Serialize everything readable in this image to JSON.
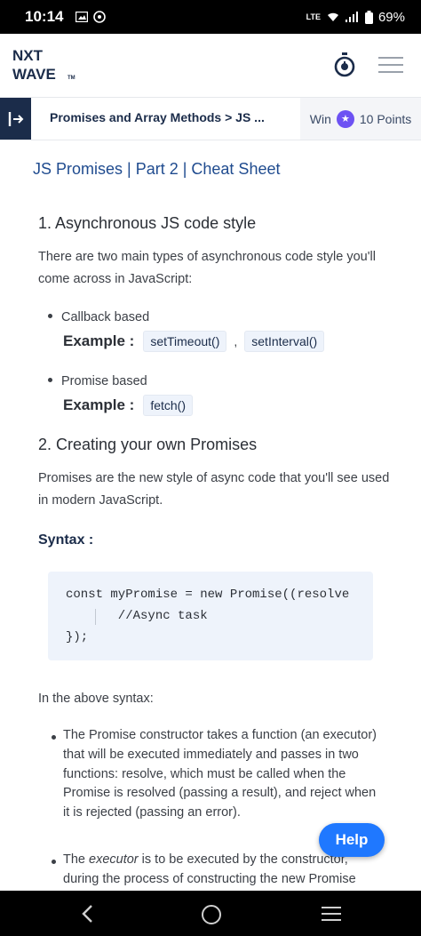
{
  "status_bar": {
    "time": "10:14",
    "network": "LTE",
    "battery": "69%"
  },
  "header": {
    "logo_line1": "NXT",
    "logo_line2": "WAVE",
    "logo_tm": "TM"
  },
  "nav": {
    "breadcrumb": "Promises and Array Methods > JS ...",
    "win_label": "Win",
    "points_label": "10 Points"
  },
  "content": {
    "page_title": "JS Promises | Part 2 | Cheat Sheet",
    "section1_heading": "1. Asynchronous JS code style",
    "section1_intro": "There are two main types of asynchronous code style you'll come across in JavaScript:",
    "bullet_callback": "Callback based",
    "example_label": "Example :",
    "chip_settimeout": "setTimeout()",
    "comma": ",",
    "chip_setinterval": "setInterval()",
    "bullet_promise": "Promise based",
    "chip_fetch": "fetch()",
    "section2_heading": "2. Creating your own Promises",
    "section2_intro": "Promises are the new style of async code that you'll see used in modern JavaScript.",
    "syntax_label": "Syntax :",
    "code_lines": [
      "const myPromise = new Promise((resolve",
      "       //Async task",
      "});"
    ],
    "above_syntax": "In the above syntax:",
    "list_item1": "The Promise constructor takes a function (an executor) that will be executed immediately and passes in two functions: resolve, which must be called when the Promise is resolved (passing a result), and reject when it is rejected (passing an error).",
    "list_item2_prefix": "The ",
    "list_item2_em": "executor",
    "list_item2_suffix": " is to be executed by the constructor, during the process of constructing the new Promise"
  },
  "help_button": "Help",
  "icons": {
    "timer": "stopwatch-icon",
    "menu": "hamburger-menu-icon",
    "sidebar": "sidebar-expand-icon",
    "star": "star-badge-icon"
  },
  "colors": {
    "brand_navy": "#1b2c4a",
    "title_blue": "#1f4b8f",
    "help_blue": "#1f78ff",
    "code_bg": "#eef3fb",
    "badge_purple": "#6d52f3"
  }
}
